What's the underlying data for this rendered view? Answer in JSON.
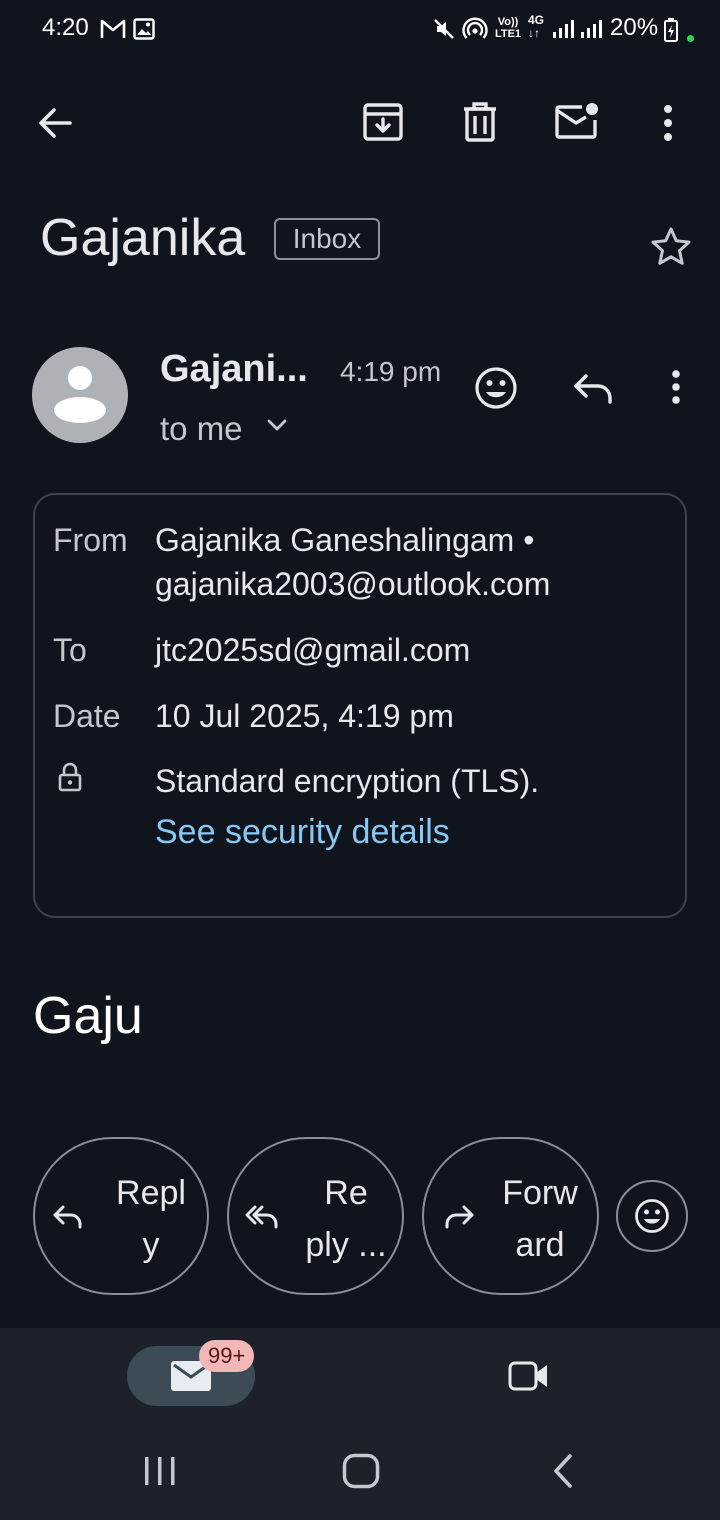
{
  "status_bar": {
    "time": "4:20",
    "battery_percent": "20%",
    "network_volte": "Vo)) LTE1",
    "network_type": "4G"
  },
  "toolbar": {
    "back_icon": "arrow-left-icon",
    "archive_icon": "archive-icon",
    "delete_icon": "trash-icon",
    "mark_unread_icon": "mail-unread-icon",
    "more_icon": "more-vert-icon"
  },
  "thread": {
    "title": "Gajanika",
    "label": "Inbox"
  },
  "message": {
    "sender_short": "Gajani...",
    "time": "4:19 pm",
    "recipient_summary": "to me",
    "details": {
      "from_label": "From",
      "from_name": "Gajanika Ganeshalingam •",
      "from_email": "gajanika2003@outlook.com",
      "to_label": "To",
      "to_value": "jtc2025sd@gmail.com",
      "date_label": "Date",
      "date_value": "10 Jul 2025, 4:19 pm",
      "encryption_text": "Standard encryption (TLS).",
      "security_link": "See security details"
    },
    "body": "Gaju"
  },
  "actions": {
    "reply_line1": "Repl",
    "reply_line2": "y",
    "reply_all_line1": "Re",
    "reply_all_line2": "ply ...",
    "forward_line1": "Forw",
    "forward_line2": "ard"
  },
  "bottom_nav": {
    "mail_badge": "99+"
  },
  "colors": {
    "background": "#10141c",
    "link": "#8ac8f4",
    "badge": "#f2b8b8",
    "nav_bg": "#1d222a"
  }
}
